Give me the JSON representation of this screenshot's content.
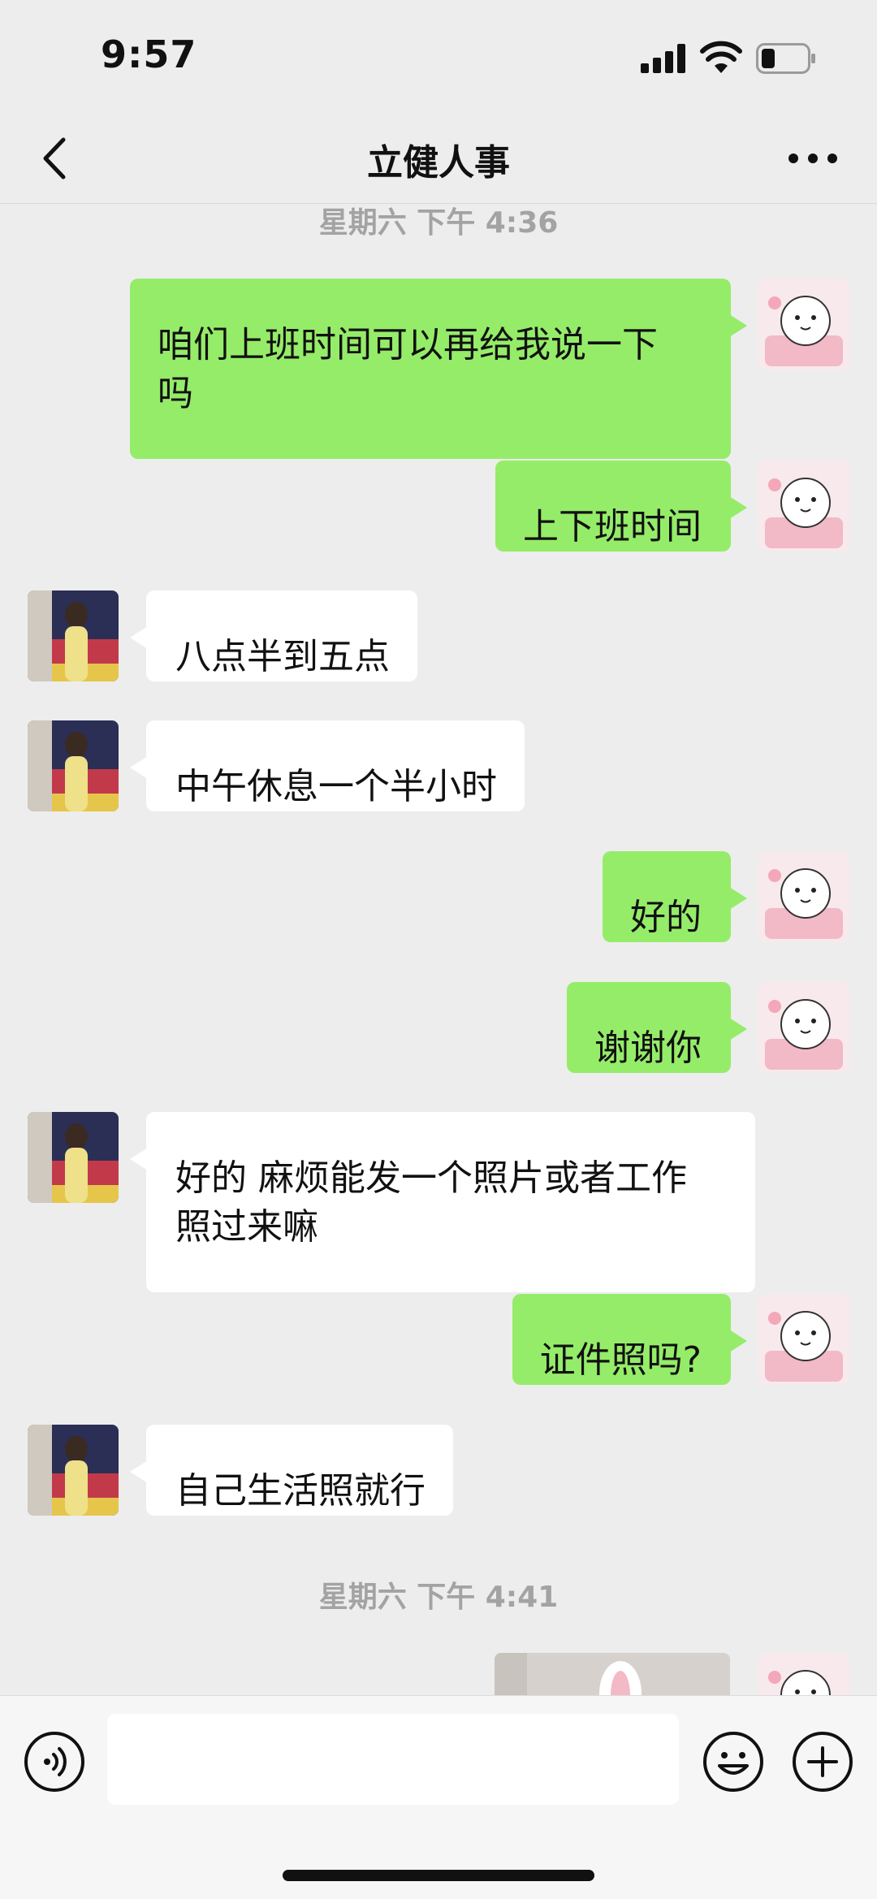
{
  "status_bar": {
    "time": "9:57"
  },
  "header": {
    "title": "立健人事",
    "back_icon": "chevron-left-icon",
    "more_icon": "ellipsis-icon"
  },
  "timestamps": [
    "星期六 下午 4:36",
    "星期六 下午 4:41"
  ],
  "messages": [
    {
      "from": "me",
      "text_lines": [
        "咱们上班时间可以再给我说一下",
        "吗"
      ]
    },
    {
      "from": "me",
      "text_lines": [
        "上下班时间"
      ]
    },
    {
      "from": "other",
      "text_lines": [
        "八点半到五点"
      ]
    },
    {
      "from": "other",
      "text_lines": [
        "中午休息一个半小时"
      ]
    },
    {
      "from": "me",
      "text_lines": [
        "好的"
      ]
    },
    {
      "from": "me",
      "text_lines": [
        "谢谢你"
      ]
    },
    {
      "from": "other",
      "text_lines": [
        "好的 麻烦能发一个照片或者工作",
        "照过来嘛"
      ]
    },
    {
      "from": "me",
      "text_lines": [
        "证件照吗?"
      ]
    },
    {
      "from": "other",
      "text_lines": [
        "自己生活照就行"
      ]
    }
  ],
  "input_bar": {
    "placeholder": "",
    "icons": [
      "voice-icon",
      "emoji-icon",
      "plus-icon"
    ]
  },
  "colors": {
    "my_bubble": "#95ec69",
    "their_bubble": "#ffffff",
    "background": "#ededed"
  }
}
